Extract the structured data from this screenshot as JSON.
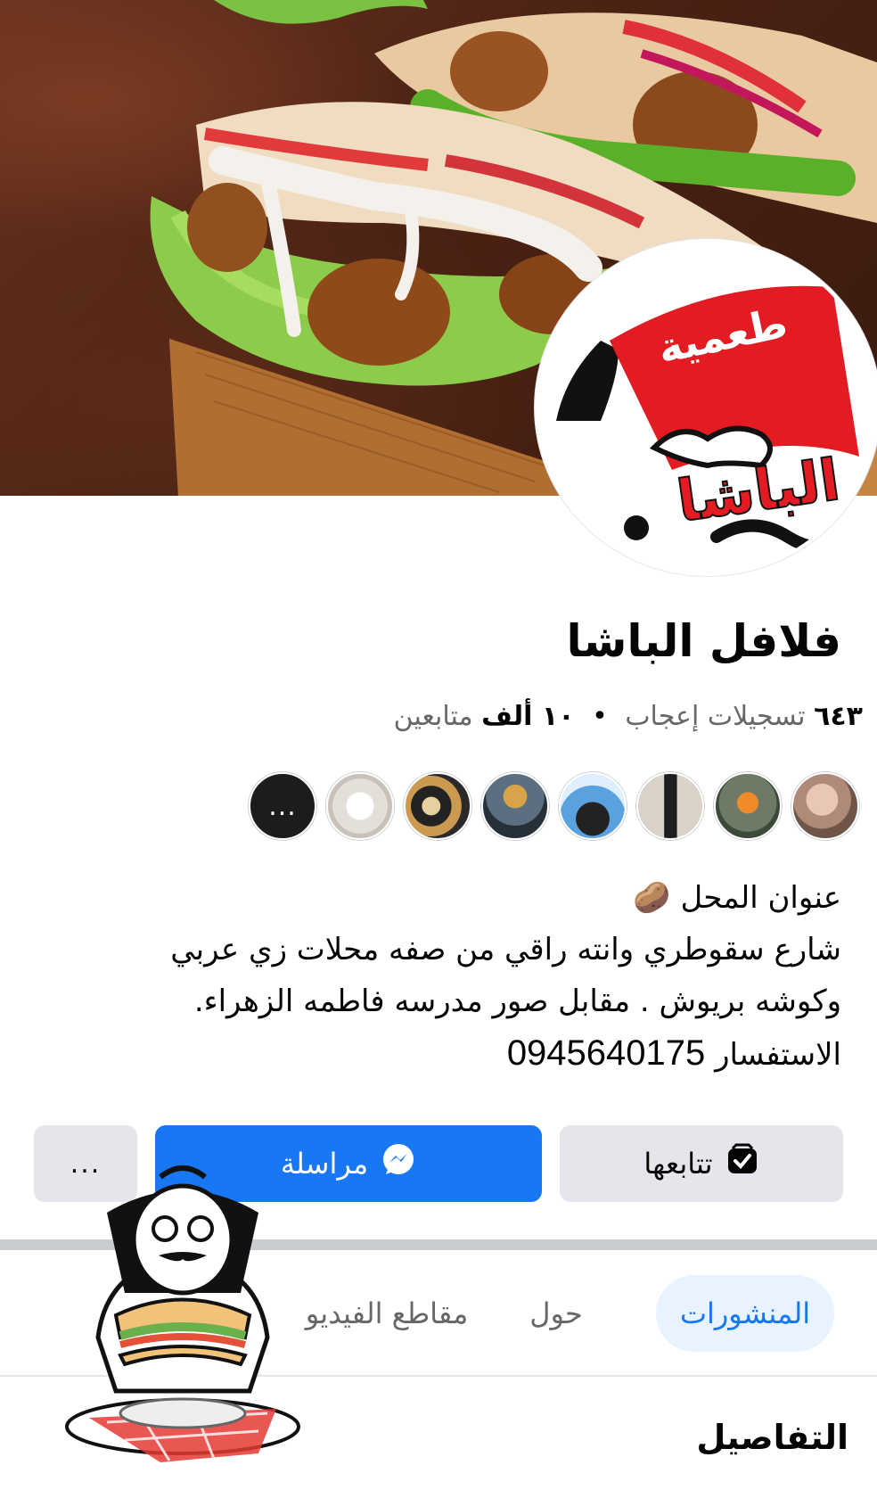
{
  "cover": {
    "description_icon": "falafel-sandwich-photo"
  },
  "avatar": {
    "line1": "طعمية",
    "line2": "الباشا"
  },
  "page": {
    "name": "فلافل الباشا",
    "likes_count": "٦٤٣",
    "likes_label": "تسجيلات إعجاب",
    "separator": "•",
    "followers_count": "١٠ ألف",
    "followers_label": "متابعين"
  },
  "friends": {
    "more_label": "..."
  },
  "bio": {
    "line1": "عنوان المحل",
    "line2": "شارع سقوطري وانته راقي من صفه محلات زي عربي",
    "line3": "وكوشه بريوش . مقابل صور مدرسه فاطمه الزهراء.",
    "line4_label": "الاستفسار",
    "phone": "0945640175"
  },
  "actions": {
    "follow_label": "تتابعها",
    "message_label": "مراسلة",
    "more_label": "..."
  },
  "tabs": [
    {
      "label": "المنشورات",
      "active": true
    },
    {
      "label": "حول",
      "active": false
    },
    {
      "label": "مقاطع الفيديو",
      "active": false
    }
  ],
  "section": {
    "title": "التفاصيل"
  },
  "colors": {
    "accent": "#1877f2",
    "tab_active_bg": "#e7f3ff",
    "button_grey": "#e4e6eb"
  }
}
